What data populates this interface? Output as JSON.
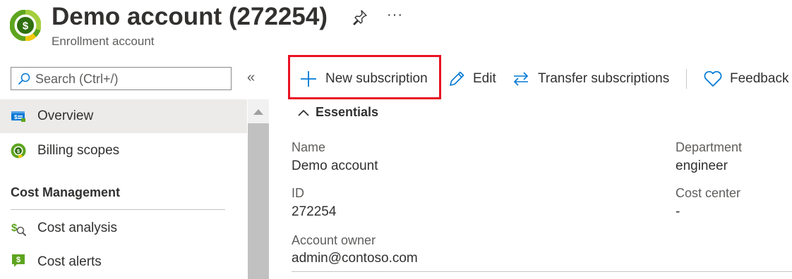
{
  "header": {
    "title": "Demo account (272254)",
    "subtitle": "Enrollment account",
    "more_label": "···",
    "icon_colors": {
      "ring_primary": "#5ea51f",
      "ring_secondary": "#f2c80f",
      "dollar_bg": "#3a7a15"
    }
  },
  "search": {
    "placeholder": "Search (Ctrl+/)",
    "collapse_label": "«"
  },
  "sidebar": {
    "items": [
      {
        "label": "Overview",
        "icon": "overview-icon",
        "selected": true
      },
      {
        "label": "Billing scopes",
        "icon": "billing-scopes-icon",
        "selected": false
      }
    ],
    "section_header": "Cost Management",
    "section_items": [
      {
        "label": "Cost analysis",
        "icon": "cost-analysis-icon"
      },
      {
        "label": "Cost alerts",
        "icon": "cost-alerts-icon"
      }
    ]
  },
  "toolbar": {
    "new_subscription": "New subscription",
    "edit": "Edit",
    "transfer": "Transfer subscriptions",
    "feedback": "Feedback",
    "accent": "#0078d4",
    "highlight": "#e81123"
  },
  "essentials": {
    "label": "Essentials",
    "left": [
      {
        "label": "Name",
        "value": "Demo account"
      },
      {
        "label": "ID",
        "value": "272254"
      },
      {
        "label": "Account owner",
        "value": "admin@contoso.com"
      }
    ],
    "right": [
      {
        "label": "Department",
        "value": "engineer"
      },
      {
        "label": "Cost center",
        "value": "-"
      }
    ]
  }
}
